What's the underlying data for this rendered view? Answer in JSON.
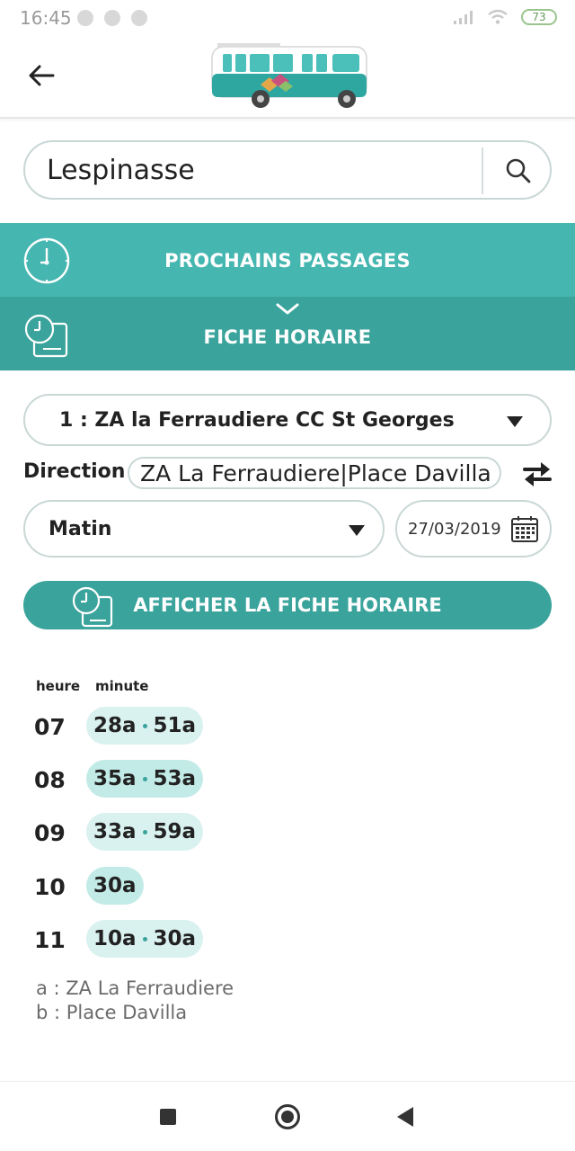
{
  "status_bar": {
    "time": "16:45",
    "battery": "73"
  },
  "search": {
    "value": "Lespinasse"
  },
  "bands": {
    "passages_label": "PROCHAINS PASSAGES",
    "fiche_label": "FICHE HORAIRE"
  },
  "controls": {
    "line_value": "1 : ZA la Ferraudiere CC St Georges",
    "direction_label": "Direction",
    "direction_value": "ZA La Ferraudiere|Place Davilla",
    "period_value": "Matin",
    "date_value": "27/03/2019",
    "show_button_label": "AFFICHER LA FICHE HORAIRE"
  },
  "timetable": {
    "col_hour": "heure",
    "col_minute": "minute",
    "rows": [
      {
        "hour": "07",
        "minutes": [
          "28a",
          "51a"
        ]
      },
      {
        "hour": "08",
        "minutes": [
          "35a",
          "53a"
        ]
      },
      {
        "hour": "09",
        "minutes": [
          "33a",
          "59a"
        ]
      },
      {
        "hour": "10",
        "minutes": [
          "30a"
        ]
      },
      {
        "hour": "11",
        "minutes": [
          "10a",
          "30a"
        ]
      }
    ],
    "legend": [
      "a : ZA La Ferraudiere",
      "b : Place Davilla"
    ]
  },
  "colors": {
    "teal_light": "#45b6b0",
    "teal_dark": "#3aa39c",
    "pill_bg": "#d9f1ef",
    "pill_bg_alt": "#c2ebe7"
  }
}
